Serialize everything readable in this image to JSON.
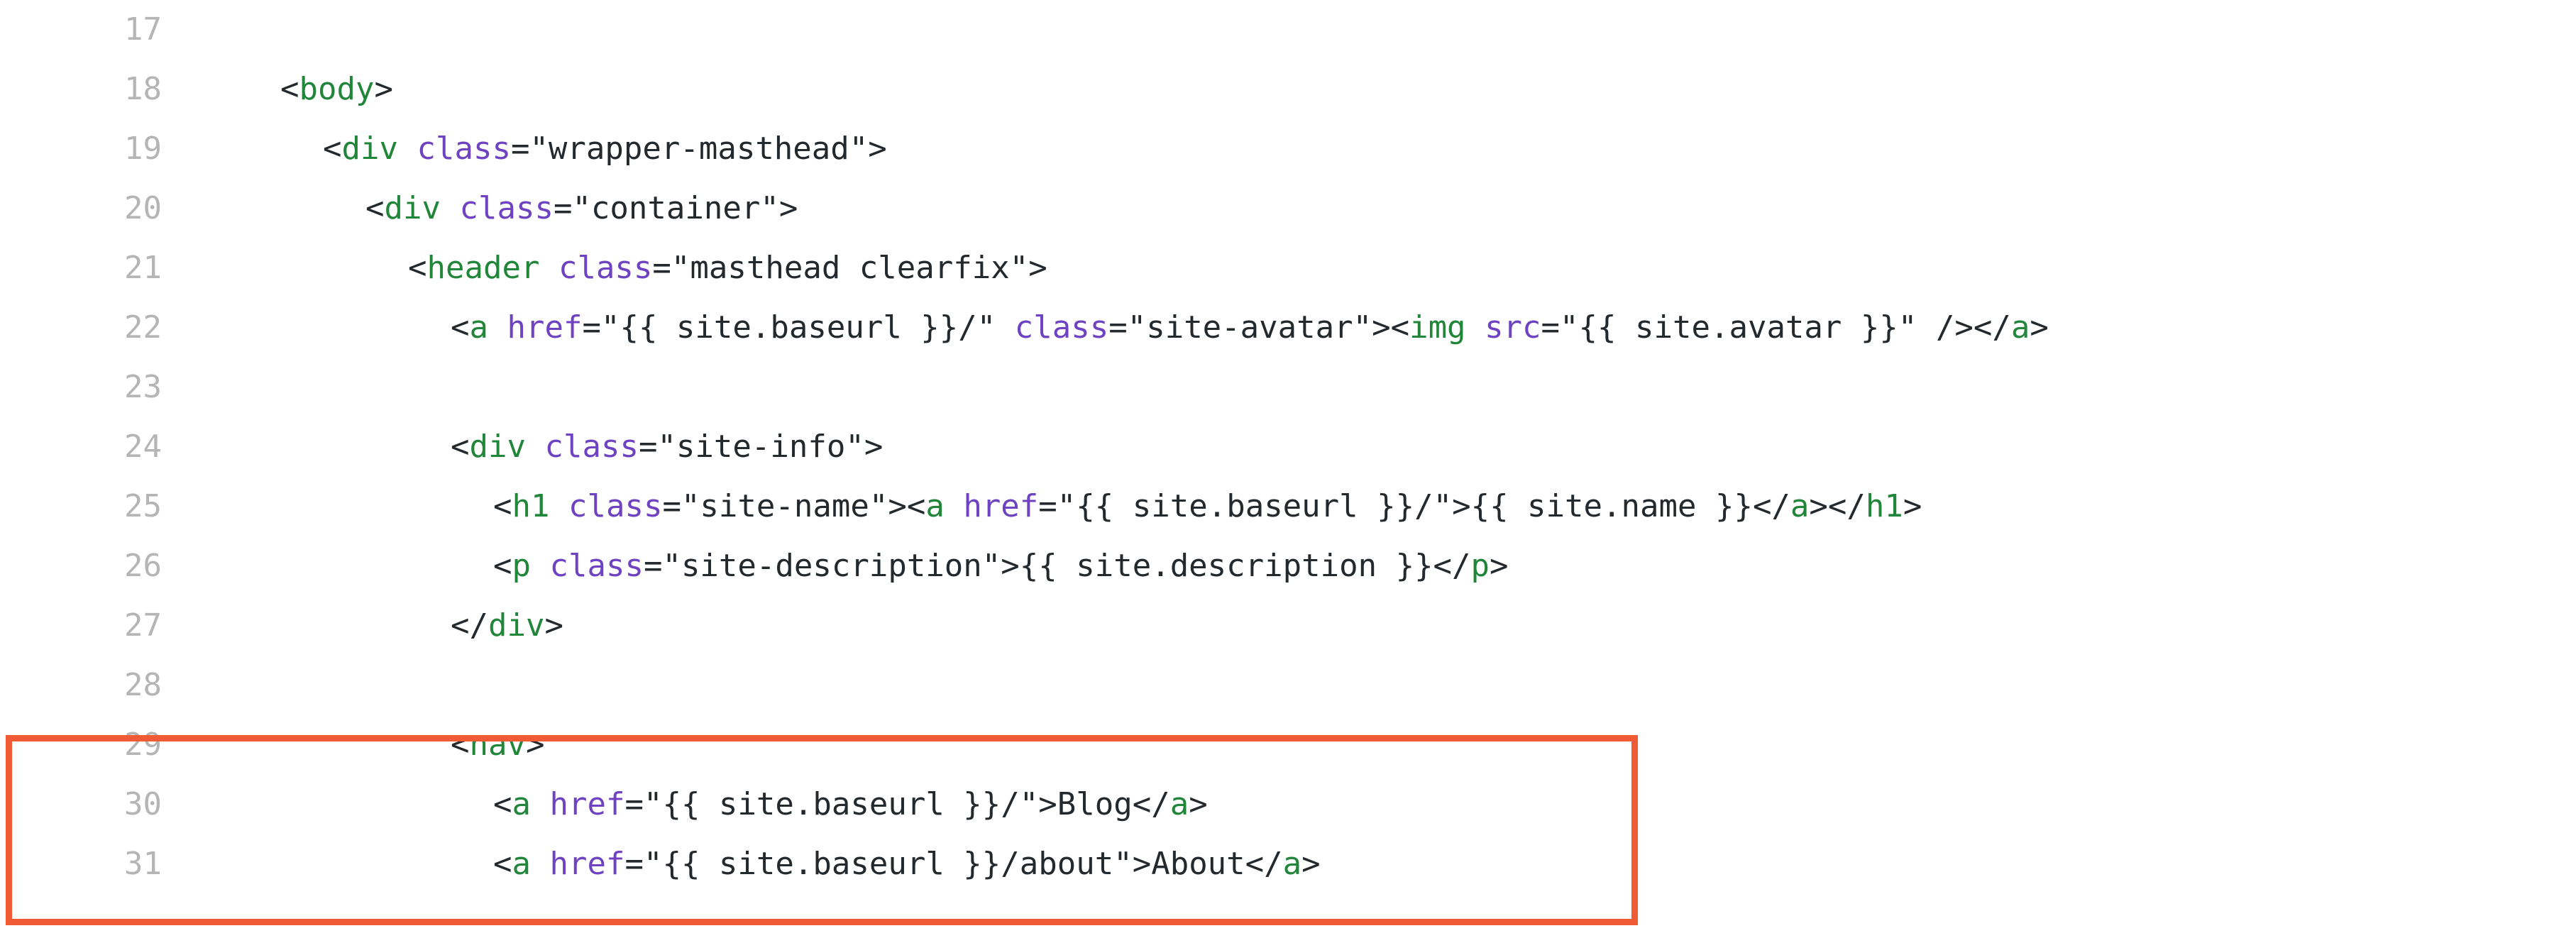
{
  "lines": [
    {
      "n": "17",
      "segs": []
    },
    {
      "n": "18",
      "segs": [
        [
          "p",
          "<"
        ],
        [
          "t",
          "body"
        ],
        [
          "p",
          ">"
        ]
      ]
    },
    {
      "n": "19",
      "segs": [
        [
          "p",
          "<"
        ],
        [
          "t",
          "div"
        ],
        [
          "p",
          " "
        ],
        [
          "a",
          "class"
        ],
        [
          "p",
          "="
        ],
        [
          "s",
          "\"wrapper-masthead\""
        ],
        [
          "p",
          ">"
        ]
      ]
    },
    {
      "n": "20",
      "segs": [
        [
          "p",
          "<"
        ],
        [
          "t",
          "div"
        ],
        [
          "p",
          " "
        ],
        [
          "a",
          "class"
        ],
        [
          "p",
          "="
        ],
        [
          "s",
          "\"container\""
        ],
        [
          "p",
          ">"
        ]
      ]
    },
    {
      "n": "21",
      "segs": [
        [
          "p",
          "<"
        ],
        [
          "t",
          "header"
        ],
        [
          "p",
          " "
        ],
        [
          "a",
          "class"
        ],
        [
          "p",
          "="
        ],
        [
          "s",
          "\"masthead clearfix\""
        ],
        [
          "p",
          ">"
        ]
      ]
    },
    {
      "n": "22",
      "segs": [
        [
          "p",
          "<"
        ],
        [
          "t",
          "a"
        ],
        [
          "p",
          " "
        ],
        [
          "a",
          "href"
        ],
        [
          "p",
          "="
        ],
        [
          "s",
          "\"{{ site.baseurl }}/\""
        ],
        [
          "p",
          " "
        ],
        [
          "a",
          "class"
        ],
        [
          "p",
          "="
        ],
        [
          "s",
          "\"site-avatar\""
        ],
        [
          "p",
          "><"
        ],
        [
          "t",
          "img"
        ],
        [
          "p",
          " "
        ],
        [
          "a",
          "src"
        ],
        [
          "p",
          "="
        ],
        [
          "s",
          "\"{{ site.avatar }}\""
        ],
        [
          "p",
          " /></"
        ],
        [
          "t",
          "a"
        ],
        [
          "p",
          ">"
        ]
      ]
    },
    {
      "n": "23",
      "segs": []
    },
    {
      "n": "24",
      "segs": [
        [
          "p",
          "<"
        ],
        [
          "t",
          "div"
        ],
        [
          "p",
          " "
        ],
        [
          "a",
          "class"
        ],
        [
          "p",
          "="
        ],
        [
          "s",
          "\"site-info\""
        ],
        [
          "p",
          ">"
        ]
      ]
    },
    {
      "n": "25",
      "segs": [
        [
          "p",
          "<"
        ],
        [
          "t",
          "h1"
        ],
        [
          "p",
          " "
        ],
        [
          "a",
          "class"
        ],
        [
          "p",
          "="
        ],
        [
          "s",
          "\"site-name\""
        ],
        [
          "p",
          "><"
        ],
        [
          "t",
          "a"
        ],
        [
          "p",
          " "
        ],
        [
          "a",
          "href"
        ],
        [
          "p",
          "="
        ],
        [
          "s",
          "\"{{ site.baseurl }}/\""
        ],
        [
          "p",
          ">{{ site.name }}</"
        ],
        [
          "t",
          "a"
        ],
        [
          "p",
          "></"
        ],
        [
          "t",
          "h1"
        ],
        [
          "p",
          ">"
        ]
      ]
    },
    {
      "n": "26",
      "segs": [
        [
          "p",
          "<"
        ],
        [
          "t",
          "p"
        ],
        [
          "p",
          " "
        ],
        [
          "a",
          "class"
        ],
        [
          "p",
          "="
        ],
        [
          "s",
          "\"site-description\""
        ],
        [
          "p",
          ">{{ site.description }}</"
        ],
        [
          "t",
          "p"
        ],
        [
          "p",
          ">"
        ]
      ]
    },
    {
      "n": "27",
      "segs": [
        [
          "p",
          "</"
        ],
        [
          "t",
          "div"
        ],
        [
          "p",
          ">"
        ]
      ]
    },
    {
      "n": "28",
      "segs": []
    },
    {
      "n": "29",
      "segs": [
        [
          "p",
          "<"
        ],
        [
          "t",
          "nav"
        ],
        [
          "p",
          ">"
        ]
      ]
    },
    {
      "n": "30",
      "segs": [
        [
          "p",
          "<"
        ],
        [
          "t",
          "a"
        ],
        [
          "p",
          " "
        ],
        [
          "a",
          "href"
        ],
        [
          "p",
          "="
        ],
        [
          "s",
          "\"{{ site.baseurl }}/\""
        ],
        [
          "p",
          ">Blog</"
        ],
        [
          "t",
          "a"
        ],
        [
          "p",
          ">"
        ]
      ]
    },
    {
      "n": "31",
      "segs": [
        [
          "p",
          "<"
        ],
        [
          "t",
          "a"
        ],
        [
          "p",
          " "
        ],
        [
          "a",
          "href"
        ],
        [
          "p",
          "="
        ],
        [
          "s",
          "\"{{ site.baseurl }}/about\""
        ],
        [
          "p",
          ">About</"
        ],
        [
          "t",
          "a"
        ],
        [
          "p",
          ">"
        ]
      ]
    }
  ],
  "colors": {
    "tag": "#22863a",
    "attr": "#6f42c1",
    "text": "#24292e",
    "line_number": "#b5b5b5",
    "highlight": "#f05a34"
  }
}
